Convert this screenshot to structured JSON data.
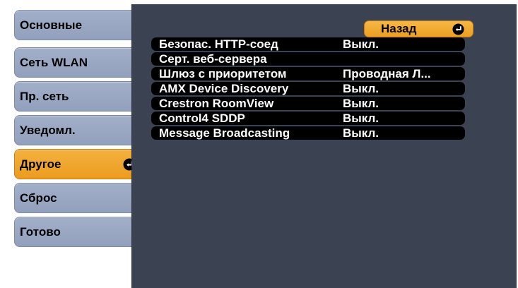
{
  "tabs": [
    {
      "label": "Основные",
      "active": false
    },
    {
      "label": "Сеть WLAN",
      "active": false
    },
    {
      "label": "Пр. сеть",
      "active": false
    },
    {
      "label": "Уведомл.",
      "active": false
    },
    {
      "label": "Другое",
      "active": true
    },
    {
      "label": "Сброс",
      "active": false
    },
    {
      "label": "Готово",
      "active": false
    }
  ],
  "panel": {
    "back_label": "Назад",
    "rows": [
      {
        "label": "Безопас. HTTP-соед",
        "value": "Выкл."
      },
      {
        "label": "Серт. веб-сервера",
        "value": ""
      },
      {
        "label": "Шлюз с приоритетом",
        "value": "Проводная Л..."
      },
      {
        "label": "AMX Device Discovery",
        "value": "Выкл."
      },
      {
        "label": "Crestron RoomView",
        "value": "Выкл."
      },
      {
        "label": "Control4 SDDP",
        "value": "Выкл."
      },
      {
        "label": "Message Broadcasting",
        "value": "Выкл."
      }
    ]
  },
  "icons": {
    "enter": "enter-icon"
  },
  "colors": {
    "tab": "#9aa7c3",
    "tab_active": "#f0a62e",
    "panel_bg": "#3b4252",
    "row_bg": "#000000",
    "row_text": "#ffffff"
  }
}
